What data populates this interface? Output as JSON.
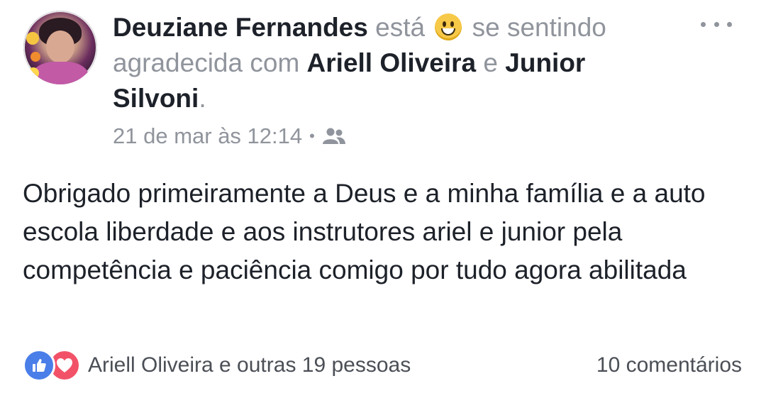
{
  "post": {
    "author": "Deuziane Fernandes",
    "esta": "está",
    "feeling_part1": "se sentindo",
    "feeling_part2": "agradecida com",
    "tag1": "Ariell Oliveira",
    "e": "e",
    "tag2_part1": "Junior",
    "tag2_part2": "Silvoni",
    "period": ".",
    "timestamp": "21 de mar às 12:14",
    "separator": "•",
    "audience_icon": "friends-icon",
    "feeling_icon": "smiley-icon",
    "body": "Obrigado primeiramente a Deus e a minha família e a auto escola liberdade e aos  instrutores ariel e junior pela competência e  paciência comigo por tudo agora abilitada"
  },
  "reactions": {
    "text": "Ariell Oliveira e outras 19 pessoas",
    "icons": [
      "like-icon",
      "love-icon"
    ],
    "like_color": "#4a7ee8",
    "love_color": "#f25268"
  },
  "comments": {
    "text": "10 comentários"
  }
}
